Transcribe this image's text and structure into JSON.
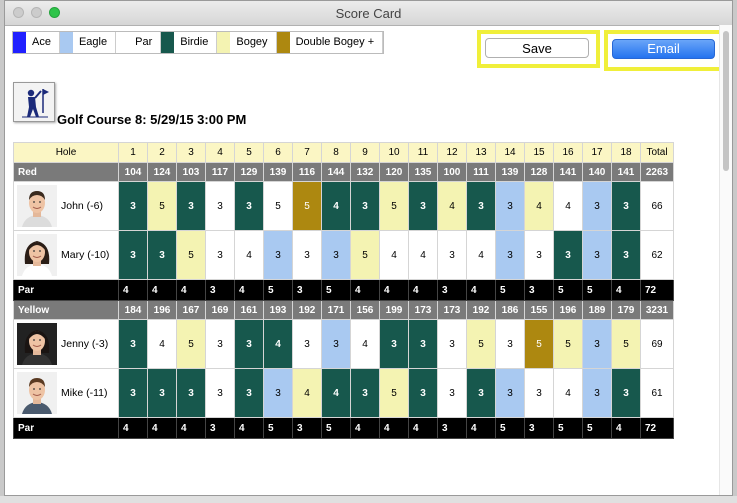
{
  "window": {
    "title": "Score Card"
  },
  "legend": [
    {
      "label": "Ace",
      "color": "#2020ff"
    },
    {
      "label": "Eagle",
      "color": "#a9c9f1"
    },
    {
      "label": "Par",
      "color": "#ffffff"
    },
    {
      "label": "Birdie",
      "color": "#17584d"
    },
    {
      "label": "Bogey",
      "color": "#f4f3b2"
    },
    {
      "label": "Double Bogey +",
      "color": "#ad8810"
    }
  ],
  "buttons": {
    "save": "Save",
    "email": "Email"
  },
  "course": "Golf Course 8: 5/29/15 3:00 PM",
  "table": {
    "hole_label": "Hole",
    "holes": [
      "1",
      "2",
      "3",
      "4",
      "5",
      "6",
      "7",
      "8",
      "9",
      "10",
      "11",
      "12",
      "13",
      "14",
      "15",
      "16",
      "17",
      "18"
    ],
    "total_label": "Total",
    "par_label": "Par",
    "groups": [
      {
        "tee": "Red",
        "yardage": [
          "104",
          "124",
          "103",
          "117",
          "129",
          "139",
          "116",
          "144",
          "132",
          "120",
          "135",
          "100",
          "111",
          "139",
          "128",
          "141",
          "140",
          "141"
        ],
        "yardage_total": "2263",
        "players": [
          {
            "name": "John (-6)",
            "avatar": "male-1",
            "scores": [
              "3",
              "5",
              "3",
              "3",
              "3",
              "5",
              "5",
              "4",
              "3",
              "5",
              "3",
              "4",
              "3",
              "3",
              "4",
              "4",
              "3",
              "3"
            ],
            "classes": [
              "birdie",
              "bogey",
              "birdie",
              "par-s",
              "birdie",
              "par-s",
              "dbogey",
              "birdie",
              "birdie",
              "bogey",
              "birdie",
              "bogey",
              "birdie",
              "eagle",
              "bogey",
              "par-s",
              "eagle",
              "birdie"
            ],
            "total": "66"
          },
          {
            "name": "Mary (-10)",
            "avatar": "female-1",
            "scores": [
              "3",
              "3",
              "5",
              "3",
              "4",
              "3",
              "3",
              "3",
              "5",
              "4",
              "4",
              "3",
              "4",
              "3",
              "3",
              "3",
              "3",
              "3"
            ],
            "classes": [
              "birdie",
              "birdie",
              "bogey",
              "par-s",
              "par-s",
              "eagle",
              "par-s",
              "eagle",
              "bogey",
              "par-s",
              "par-s",
              "par-s",
              "par-s",
              "eagle",
              "par-s",
              "birdie",
              "eagle",
              "birdie"
            ],
            "total": "62"
          }
        ],
        "par": [
          "4",
          "4",
          "4",
          "3",
          "4",
          "5",
          "3",
          "5",
          "4",
          "4",
          "4",
          "3",
          "4",
          "5",
          "3",
          "5",
          "5",
          "4"
        ],
        "par_total": "72"
      },
      {
        "tee": "Yellow",
        "yardage": [
          "184",
          "196",
          "167",
          "169",
          "161",
          "193",
          "192",
          "171",
          "156",
          "199",
          "173",
          "173",
          "192",
          "186",
          "155",
          "196",
          "189",
          "179"
        ],
        "yardage_total": "3231",
        "players": [
          {
            "name": "Jenny (-3)",
            "avatar": "female-2",
            "scores": [
              "3",
              "4",
              "5",
              "3",
              "3",
              "4",
              "3",
              "3",
              "4",
              "3",
              "3",
              "3",
              "5",
              "3",
              "5",
              "5",
              "3",
              "5"
            ],
            "classes": [
              "birdie",
              "par-s",
              "bogey",
              "par-s",
              "birdie",
              "birdie",
              "par-s",
              "eagle",
              "par-s",
              "birdie",
              "birdie",
              "par-s",
              "bogey",
              "par-s",
              "dbogey",
              "bogey",
              "eagle",
              "bogey"
            ],
            "total": "69"
          },
          {
            "name": "Mike (-11)",
            "avatar": "male-2",
            "scores": [
              "3",
              "3",
              "3",
              "3",
              "3",
              "3",
              "4",
              "4",
              "3",
              "5",
              "3",
              "3",
              "3",
              "3",
              "3",
              "4",
              "3",
              "3"
            ],
            "classes": [
              "birdie",
              "birdie",
              "birdie",
              "par-s",
              "birdie",
              "eagle",
              "bogey",
              "birdie",
              "birdie",
              "bogey",
              "birdie",
              "par-s",
              "birdie",
              "eagle",
              "par-s",
              "par-s",
              "eagle",
              "birdie"
            ],
            "total": "61"
          }
        ],
        "par": [
          "4",
          "4",
          "4",
          "3",
          "4",
          "5",
          "3",
          "5",
          "4",
          "4",
          "4",
          "3",
          "4",
          "5",
          "3",
          "5",
          "5",
          "4"
        ],
        "par_total": "72"
      }
    ]
  }
}
